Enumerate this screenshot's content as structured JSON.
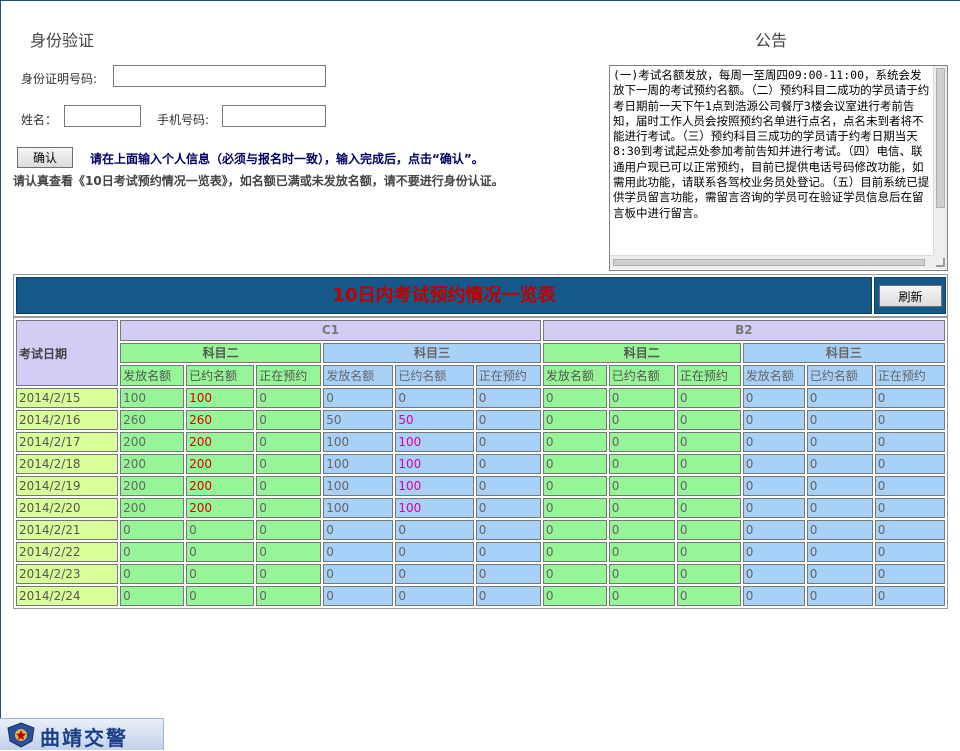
{
  "auth": {
    "title": "身份验证",
    "id_label": "身份证明号码:",
    "id_value": "",
    "name_label": "姓名：",
    "name_value": "",
    "phone_label": "手机号码:",
    "phone_value": "",
    "confirm_label": "确认",
    "hint1": "请在上面输入个人信息（必须与报名时一致），输入完成后，点击“确认”。",
    "hint2": "请认真查看《10日考试预约情况一览表》，如名额已满或未发放名额，请不要进行身份认证。"
  },
  "notice": {
    "title": "公告",
    "text": "(一)考试名额发放，每周一至周四09:00-11:00，系统会发放下一周的考试预约名额。（二）预约科目二成功的学员请于约考日期前一天下午1点到浩源公司餐厅3楼会议室进行考前告知，届时工作人员会按照预约名单进行点名，点名未到者将不能进行考试。（三）预约科目三成功的学员请于约考日期当天8:30到考试起点处参加考前告知并进行考试。（四）电信、联通用户现已可以正常预约，目前已提供电话号码修改功能，如需用此功能，请联系各驾校业务员处登记。（五）目前系统已提供学员留言功能，需留言咨询的学员可在验证学员信息后在留言板中进行留言。"
  },
  "table": {
    "title": "10日内考试预约情况一览表",
    "refresh_label": "刷新",
    "date_header": "考试日期",
    "licenses": [
      "C1",
      "B2"
    ],
    "subjects": [
      "科目二",
      "科目三",
      "科目二",
      "科目三"
    ],
    "columns": [
      "发放名额",
      "已约名额",
      "正在预约",
      "发放名额",
      "已约名额",
      "正在预约",
      "发放名额",
      "已约名额",
      "正在预约",
      "发放名额",
      "已约名额",
      "正在预约"
    ],
    "rows": [
      {
        "date": "2014/2/15",
        "values": [
          "100",
          "100",
          "0",
          "0",
          "0",
          "0",
          "0",
          "0",
          "0",
          "0",
          "0",
          "0"
        ]
      },
      {
        "date": "2014/2/16",
        "values": [
          "260",
          "260",
          "0",
          "50",
          "50",
          "0",
          "0",
          "0",
          "0",
          "0",
          "0",
          "0"
        ]
      },
      {
        "date": "2014/2/17",
        "values": [
          "200",
          "200",
          "0",
          "100",
          "100",
          "0",
          "0",
          "0",
          "0",
          "0",
          "0",
          "0"
        ]
      },
      {
        "date": "2014/2/18",
        "values": [
          "200",
          "200",
          "0",
          "100",
          "100",
          "0",
          "0",
          "0",
          "0",
          "0",
          "0",
          "0"
        ]
      },
      {
        "date": "2014/2/19",
        "values": [
          "200",
          "200",
          "0",
          "100",
          "100",
          "0",
          "0",
          "0",
          "0",
          "0",
          "0",
          "0"
        ]
      },
      {
        "date": "2014/2/20",
        "values": [
          "200",
          "200",
          "0",
          "100",
          "100",
          "0",
          "0",
          "0",
          "0",
          "0",
          "0",
          "0"
        ]
      },
      {
        "date": "2014/2/21",
        "values": [
          "0",
          "0",
          "0",
          "0",
          "0",
          "0",
          "0",
          "0",
          "0",
          "0",
          "0",
          "0"
        ]
      },
      {
        "date": "2014/2/22",
        "values": [
          "0",
          "0",
          "0",
          "0",
          "0",
          "0",
          "0",
          "0",
          "0",
          "0",
          "0",
          "0"
        ]
      },
      {
        "date": "2014/2/23",
        "values": [
          "0",
          "0",
          "0",
          "0",
          "0",
          "0",
          "0",
          "0",
          "0",
          "0",
          "0",
          "0"
        ]
      },
      {
        "date": "2014/2/24",
        "values": [
          "0",
          "0",
          "0",
          "0",
          "0",
          "0",
          "0",
          "0",
          "0",
          "0",
          "0",
          "0"
        ]
      }
    ]
  },
  "footer": {
    "logo_text": "曲靖交警",
    "logo_icon": "police-badge-icon"
  },
  "colors": {
    "title_bar": "#15598a",
    "title_text": "#c00000",
    "subject2_cell": "#96f596",
    "subject3_cell": "#a8d1f8",
    "date_cell": "#d9ff9a",
    "header_cell": "#d3ccf5",
    "booked_subject2": "#e00000",
    "booked_subject3": "#e000a0"
  }
}
